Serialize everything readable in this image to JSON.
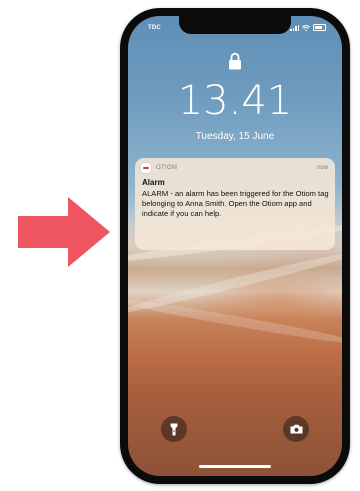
{
  "status_bar": {
    "carrier": "TDC",
    "signal_icon": "cellular-signal-icon",
    "wifi_icon": "wifi-icon",
    "battery_icon": "battery-icon"
  },
  "lock_screen": {
    "lock_icon": "padlock-icon",
    "time": "13.41",
    "date": "Tuesday, 15 June"
  },
  "notification": {
    "app_name": "OTIOM",
    "time": "now",
    "title": "Alarm",
    "body": "ALARM - an alarm has been triggered for the Otiom tag belonging to Anna Smith. Open the Otiom app and indicate if you can help."
  },
  "quick_actions": {
    "flashlight_icon": "flashlight-icon",
    "camera_icon": "camera-icon"
  },
  "colors": {
    "arrow": "#ef5560",
    "phone_frame": "#0b0b0b"
  }
}
